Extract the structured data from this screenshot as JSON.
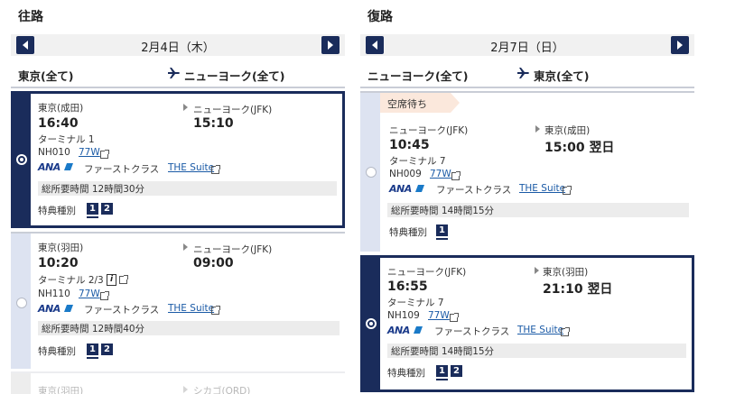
{
  "outbound": {
    "title": "往路",
    "date": "2月4日（木）",
    "from": "東京(全て)",
    "to": "ニューヨーク(全て)",
    "flights": [
      {
        "dep_airport": "東京(成田)",
        "dep_time": "16:40",
        "arr_airport": "ニューヨーク(JFK)",
        "arr_time": "15:10",
        "terminal": "ターミナル 1",
        "flight_no": "NH010",
        "aircraft": "77W",
        "airline": "ANA",
        "cabin": "ファーストクラス",
        "product": "THE Suite",
        "duration": "総所要時間 12時間30分",
        "award_label": "特典種別",
        "award_types": [
          "1",
          "2"
        ]
      },
      {
        "dep_airport": "東京(羽田)",
        "dep_time": "10:20",
        "arr_airport": "ニューヨーク(JFK)",
        "arr_time": "09:00",
        "terminal": "ターミナル 2/3",
        "flight_no": "NH110",
        "aircraft": "77W",
        "airline": "ANA",
        "cabin": "ファーストクラス",
        "product": "THE Suite",
        "duration": "総所要時間 12時間40分",
        "award_label": "特典種別",
        "award_types": [
          "1",
          "2"
        ]
      },
      {
        "dep_airport": "東京(羽田)",
        "arr_airport": "シカゴ(ORD)"
      }
    ]
  },
  "return": {
    "title": "復路",
    "date": "2月7日（日）",
    "from": "ニューヨーク(全て)",
    "to": "東京(全て)",
    "flights": [
      {
        "status": "空席待ち",
        "dep_airport": "ニューヨーク(JFK)",
        "dep_time": "10:45",
        "arr_airport": "東京(成田)",
        "arr_time": "15:00 翌日",
        "terminal": "ターミナル 7",
        "flight_no": "NH009",
        "aircraft": "77W",
        "airline": "ANA",
        "cabin": "ファーストクラス",
        "product": "THE Suite",
        "duration": "総所要時間 14時間15分",
        "award_label": "特典種別",
        "award_types": [
          "1"
        ]
      },
      {
        "dep_airport": "ニューヨーク(JFK)",
        "dep_time": "16:55",
        "arr_airport": "東京(羽田)",
        "arr_time": "21:10 翌日",
        "terminal": "ターミナル 7",
        "flight_no": "NH109",
        "aircraft": "77W",
        "airline": "ANA",
        "cabin": "ファーストクラス",
        "product": "THE Suite",
        "duration": "総所要時間 14時間15分",
        "award_label": "特典種別",
        "award_types": [
          "1",
          "2"
        ]
      }
    ]
  },
  "colors": {
    "navy": "#1a2c5b",
    "rail": "#dde3f1",
    "link": "#1a5aa6",
    "waitlist_bg": "#fbe8dc"
  },
  "icons": [
    "chevron-left-icon",
    "chevron-right-icon",
    "airplane-icon",
    "external-link-icon",
    "info-icon",
    "ana-logo"
  ]
}
